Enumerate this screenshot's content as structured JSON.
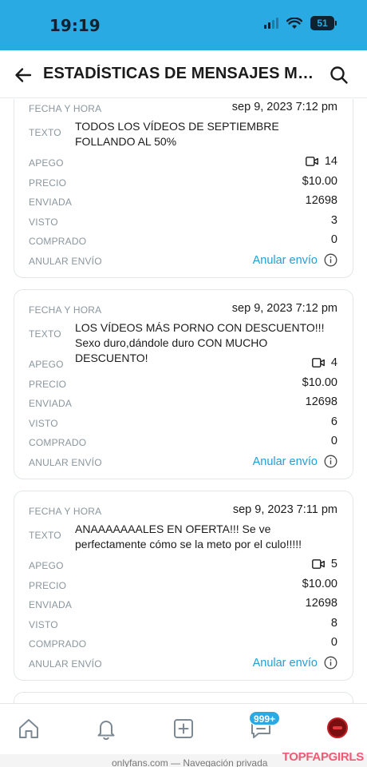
{
  "status_bar": {
    "time": "19:19",
    "battery": "51"
  },
  "header": {
    "title": "ESTADÍSTICAS DE MENSAJES MAS..."
  },
  "labels": {
    "date": "FECHA Y HORA",
    "text": "TEXTO",
    "attachment": "APEGO",
    "price": "PRECIO",
    "sent": "ENVIADA",
    "viewed": "VISTO",
    "purchased": "COMPRADO",
    "cancel": "ANULAR ENVÍO",
    "cancel_action": "Anular envío"
  },
  "messages": [
    {
      "datetime": "sep 9, 2023 7:12 pm",
      "text": "TODOS LOS VÍDEOS DE SEPTIEMBRE FOLLANDO AL 50%",
      "attachment_count": "14",
      "price": "$10.00",
      "sent": "12698",
      "viewed": "3",
      "purchased": "0"
    },
    {
      "datetime": "sep 9, 2023 7:12 pm",
      "text": "LOS VÍDEOS MÁS PORNO CON DESCUENTO!!! Sexo duro,dándole duro CON MUCHO DESCUENTO!",
      "attachment_count": "4",
      "price": "$10.00",
      "sent": "12698",
      "viewed": "6",
      "purchased": "0"
    },
    {
      "datetime": "sep 9, 2023 7:11 pm",
      "text": "ANAAAAAAALES EN OFERTA!!! Se ve perfectamente cómo se la meto por el culo!!!!!",
      "attachment_count": "5",
      "price": "$10.00",
      "sent": "12698",
      "viewed": "8",
      "purchased": "0"
    }
  ],
  "tab_bar": {
    "items": [
      "home-icon",
      "bell-icon",
      "add-post-icon",
      "messages-icon",
      "avatar"
    ],
    "messages_badge": "999+"
  },
  "bottom_url": "onlyfans.com — Navegación privada",
  "watermark": "TOPFAPGIRLS",
  "colors": {
    "accent": "#2aaae3",
    "link": "#1ea0d8",
    "label": "#8a969e"
  }
}
